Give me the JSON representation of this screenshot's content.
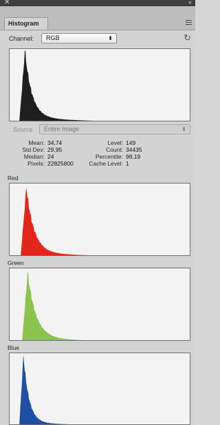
{
  "panel": {
    "tab_label": "Histogram"
  },
  "channel": {
    "label": "Channel:",
    "value": "RGB"
  },
  "source": {
    "label": "Source",
    "value": "Entire Image"
  },
  "stats": {
    "left": [
      {
        "key": "Mean:",
        "value": "34,74"
      },
      {
        "key": "Std Dev:",
        "value": "29,95"
      },
      {
        "key": "Median:",
        "value": "24"
      },
      {
        "key": "Pixels:",
        "value": "22825800"
      }
    ],
    "right": [
      {
        "key": "Level:",
        "value": "149"
      },
      {
        "key": "Count:",
        "value": "34435"
      },
      {
        "key": "Percentile:",
        "value": "98,19"
      },
      {
        "key": "Cache Level:",
        "value": "1"
      }
    ]
  },
  "histograms": [
    {
      "id": "rgb",
      "title": "",
      "color": "#1f1f1f"
    },
    {
      "id": "red",
      "title": "Red",
      "color": "#e3261b"
    },
    {
      "id": "green",
      "title": "Green",
      "color": "#8bc34f"
    },
    {
      "id": "blue",
      "title": "Blue",
      "color": "#1f4fa3"
    }
  ],
  "icons": {
    "close": "close-icon",
    "collapse": "collapse-icon",
    "menu": "panel-menu-icon",
    "refresh": "refresh-icon"
  }
}
